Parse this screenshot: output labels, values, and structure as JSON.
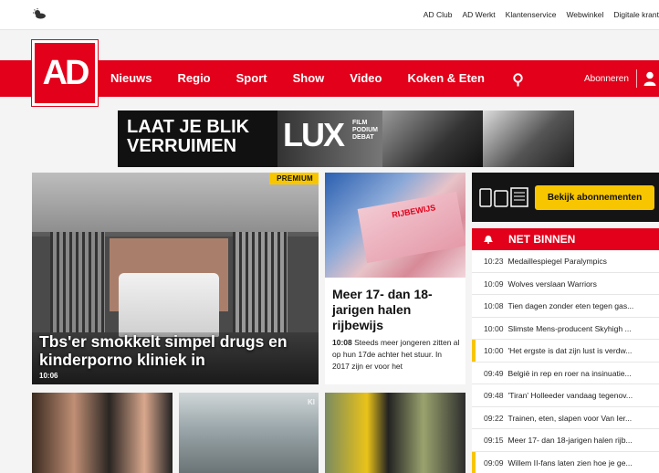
{
  "topbar": {
    "weather_icon": "cloud-sun-icon",
    "links": [
      "AD Club",
      "AD Werkt",
      "Klantenservice",
      "Webwinkel",
      "Digitale krant"
    ]
  },
  "brand": {
    "logo_text": "AD",
    "color": "#e2001a",
    "accent": "#f7c600"
  },
  "nav": {
    "items": [
      "Nieuws",
      "Regio",
      "Sport",
      "Show",
      "Video",
      "Koken & Eten"
    ],
    "search_icon": "search-icon",
    "subscribe_label": "Abonneren",
    "user_icon": "user-icon"
  },
  "banner": {
    "headline_line1": "LAAT JE BLIK",
    "headline_line2": "VERRUIMEN",
    "brand": "LUX",
    "sub_line1": "FILM",
    "sub_line2": "PODIUM",
    "sub_line3": "DEBAT"
  },
  "lead": {
    "badge": "PREMIUM",
    "title": "Tbs'er smokkelt simpel drugs en kinderporno kliniek in",
    "time": "10:06"
  },
  "article2": {
    "image_text": "RIJBEWIJS",
    "title": "Meer 17- dan 18-jarigen halen rijbewijs",
    "time": "10:08",
    "text": "Steeds meer jongeren zitten al op hun 17de achter het stuur. In 2017 zijn er voor het"
  },
  "subscription": {
    "button_label": "Bekijk abonnementen",
    "devices_icon": "devices-icon"
  },
  "net_binnen": {
    "title": "NET BINNEN",
    "icon": "alarm-icon",
    "items": [
      {
        "time": "10:23",
        "title": "Medaillespiegel Paralympics",
        "highlight": false
      },
      {
        "time": "10:09",
        "title": "Wolves verslaan Warriors",
        "highlight": false
      },
      {
        "time": "10:08",
        "title": "Tien dagen zonder eten tegen gas...",
        "highlight": false
      },
      {
        "time": "10:00",
        "title": "Slimste Mens-producent Skyhigh ...",
        "highlight": false
      },
      {
        "time": "10:00",
        "title": "'Het ergste is dat zijn lust is verdw...",
        "highlight": true
      },
      {
        "time": "09:49",
        "title": "België in rep en roer na insinuatie...",
        "highlight": false
      },
      {
        "time": "09:48",
        "title": "'Tiran' Holleeder vandaag tegenov...",
        "highlight": false
      },
      {
        "time": "09:22",
        "title": "Trainen, eten, slapen voor Van Ier...",
        "highlight": false
      },
      {
        "time": "09:15",
        "title": "Meer 17- dan 18-jarigen halen rijb...",
        "highlight": false
      },
      {
        "time": "09:09",
        "title": "Willem II-fans laten zien hoe je ge...",
        "highlight": true
      }
    ]
  },
  "thumbs": {
    "thumb2_label": "Kl"
  }
}
